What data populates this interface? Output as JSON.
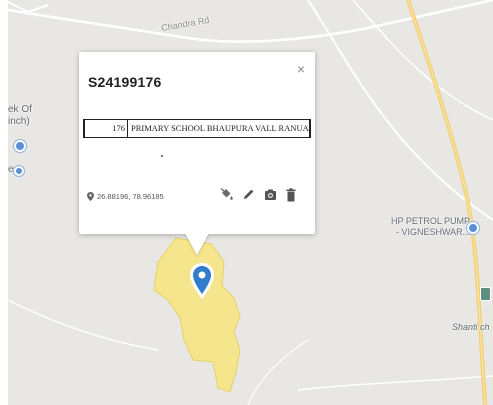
{
  "map": {
    "labels": {
      "road_top": "Chandra Rd",
      "left_top": "ek Of",
      "left_mid": "inch)",
      "left_poi": "e",
      "petrol_line1": "HP PETROL PUMP",
      "petrol_line2": "- VIGNESHWAR...",
      "shanti": "Shanti ch"
    },
    "colors": {
      "background": "#e9e7e3",
      "highway": "#f5cf72",
      "region_fill": "#f6e68a",
      "region_stroke": "#e4d060",
      "marker": "#2f7ccb",
      "poi": "#5b8fd6"
    }
  },
  "info_window": {
    "title": "S24199176",
    "close_symbol": "×",
    "field": {
      "number": "176",
      "name": "PRIMARY SCHOOL BHAUPURA VALL RANUA"
    },
    "coordinates": "26.88196, 78.96185",
    "tools": [
      "paint-bucket-icon",
      "pencil-icon",
      "camera-icon",
      "trash-icon"
    ]
  }
}
